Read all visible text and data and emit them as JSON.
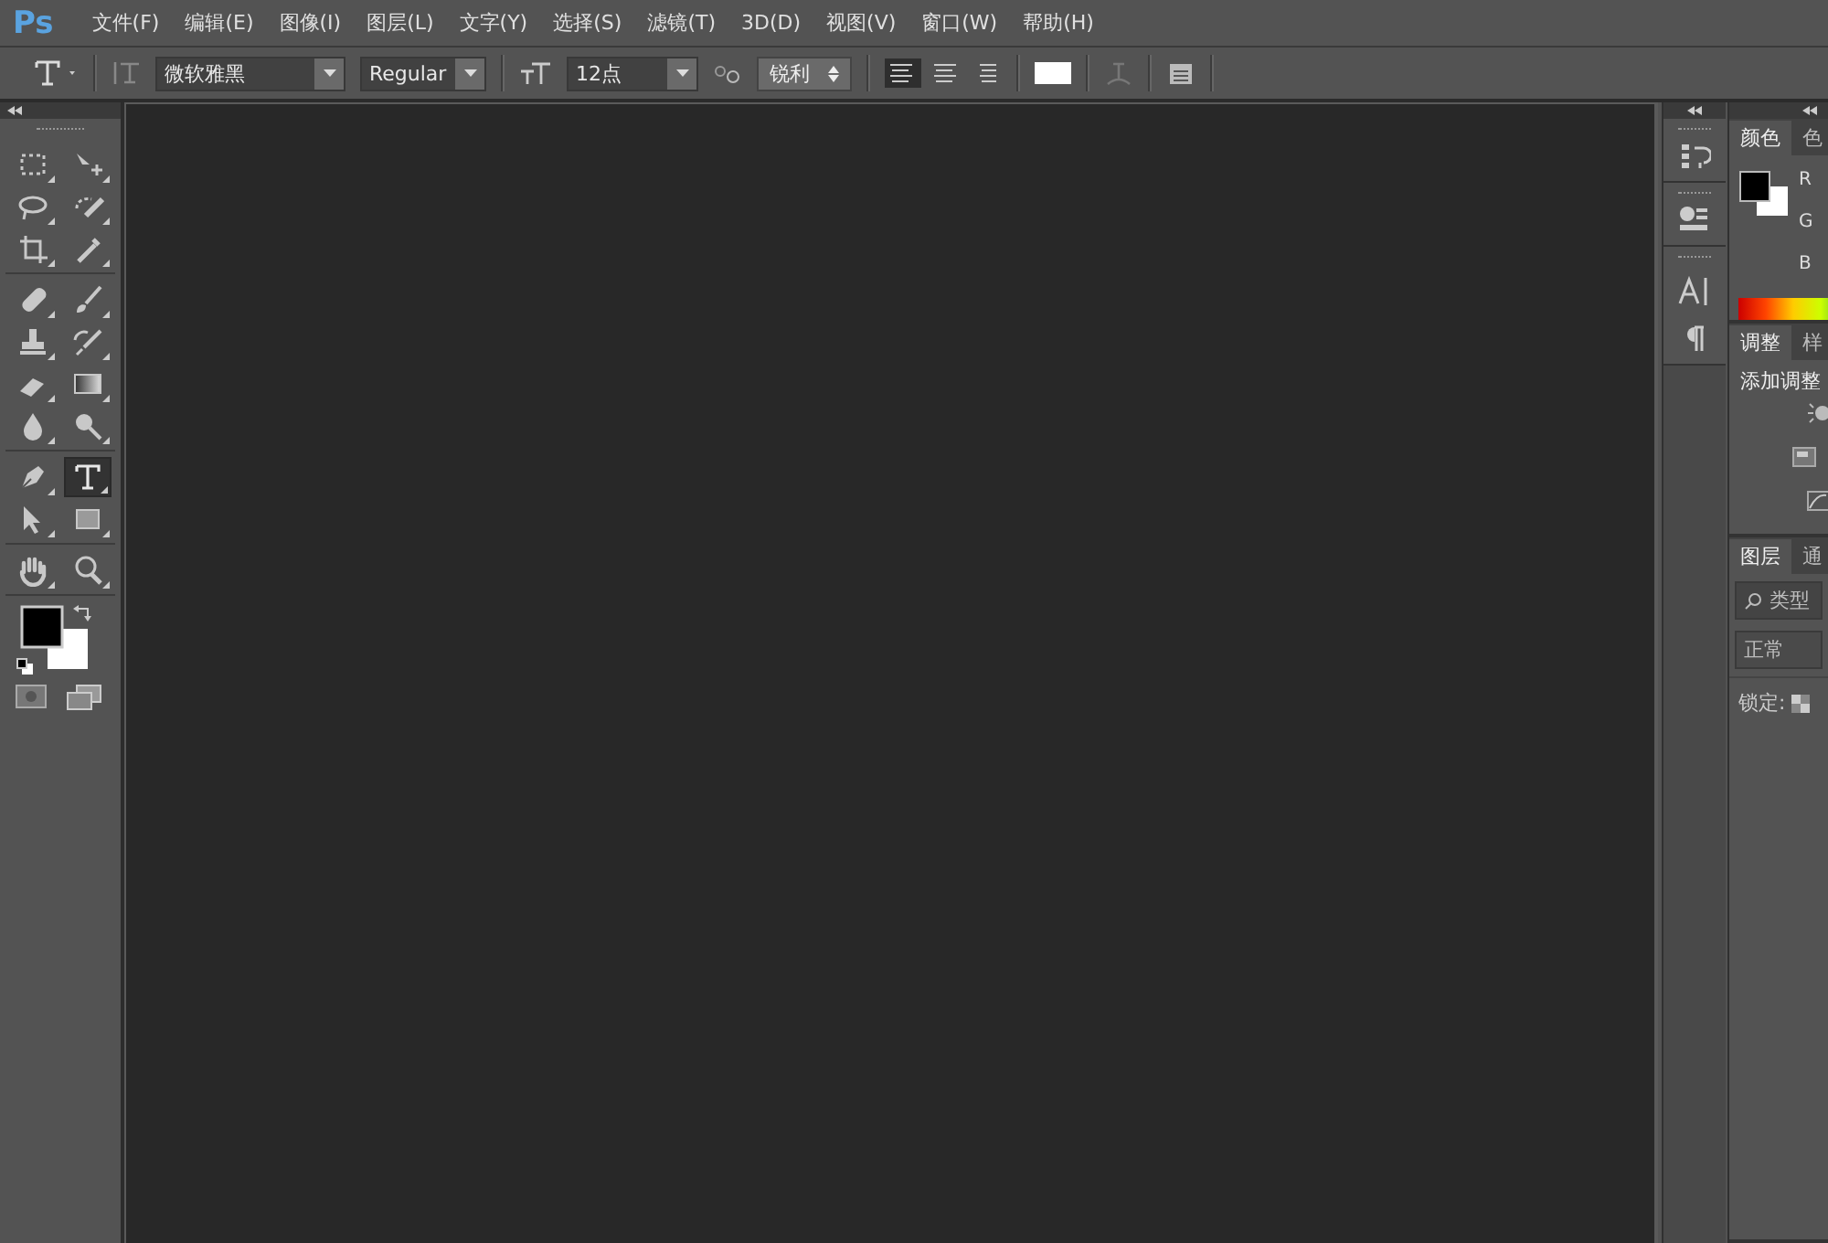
{
  "app_logo": "Ps",
  "menu": [
    "文件(F)",
    "编辑(E)",
    "图像(I)",
    "图层(L)",
    "文字(Y)",
    "选择(S)",
    "滤镜(T)",
    "3D(D)",
    "视图(V)",
    "窗口(W)",
    "帮助(H)"
  ],
  "options": {
    "font_family": "微软雅黑",
    "font_style": "Regular",
    "font_size": "12点",
    "antialias": "锐利",
    "align": [
      {
        "kind": "left",
        "selected": true
      },
      {
        "kind": "center",
        "selected": false
      },
      {
        "kind": "right",
        "selected": false
      }
    ]
  },
  "tools": [
    {
      "kind": "marquee",
      "selected": false
    },
    {
      "kind": "move",
      "selected": false
    },
    {
      "kind": "lasso",
      "selected": false
    },
    {
      "kind": "quick",
      "selected": false
    },
    {
      "kind": "crop",
      "selected": false
    },
    {
      "kind": "eyedropper",
      "selected": false
    },
    {
      "kind": "bandage",
      "selected": false
    },
    {
      "kind": "brush",
      "selected": false
    },
    {
      "kind": "stamp",
      "selected": false
    },
    {
      "kind": "history",
      "selected": false
    },
    {
      "kind": "eraser",
      "selected": false
    },
    {
      "kind": "gradient",
      "selected": false
    },
    {
      "kind": "drop",
      "selected": false
    },
    {
      "kind": "dodge",
      "selected": false
    },
    {
      "kind": "pen",
      "selected": false
    },
    {
      "kind": "type",
      "selected": true
    },
    {
      "kind": "arrow",
      "selected": false
    },
    {
      "kind": "rect",
      "selected": false
    },
    {
      "kind": "hand",
      "selected": false
    },
    {
      "kind": "zoom",
      "selected": false
    }
  ],
  "color_panel": {
    "tabs": [
      {
        "label": "颜色",
        "selected": true
      },
      {
        "label": "色",
        "selected": false
      }
    ],
    "channels": [
      "R",
      "G",
      "B"
    ]
  },
  "adjust_panel": {
    "tabs": [
      {
        "label": "调整",
        "selected": true
      },
      {
        "label": "样",
        "selected": false
      }
    ],
    "heading": "添加调整"
  },
  "layers_panel": {
    "tabs": [
      {
        "label": "图层",
        "selected": true
      },
      {
        "label": "通",
        "selected": false
      }
    ],
    "filter": "类型",
    "blend_mode": "正常",
    "lock_label": "锁定:"
  }
}
